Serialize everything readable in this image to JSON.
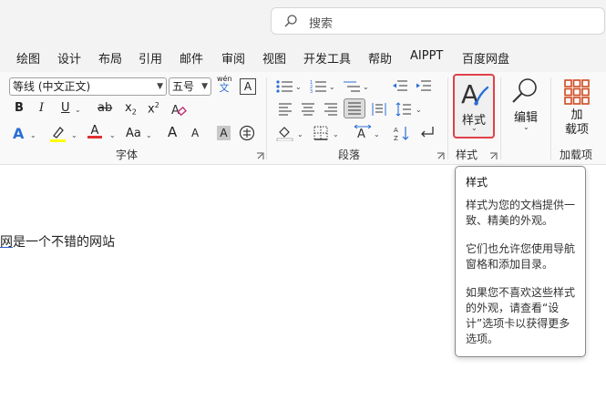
{
  "search": {
    "placeholder": "搜索",
    "icon": "search-icon"
  },
  "menu": [
    "绘图",
    "设计",
    "布局",
    "引用",
    "邮件",
    "审阅",
    "视图",
    "开发工具",
    "帮助",
    "AIPPT",
    "百度网盘"
  ],
  "font_group": {
    "font_name": "等线 (中文正文)",
    "font_size": "五号",
    "phonetic_top": "wén",
    "phonetic_bottom": "文",
    "char_border": "A",
    "bold": "B",
    "italic": "I",
    "underline": "U",
    "strike": "ab",
    "subscript": "x",
    "subscript_mark": "2",
    "superscript": "x",
    "superscript_mark": "2",
    "text_effect": "A",
    "highlight_color": "#ffff00",
    "font_color_letter": "A",
    "font_color": "#e03030",
    "change_case": "Aa",
    "grow": "A",
    "shrink": "A",
    "char_shading": "A",
    "enclose": "字",
    "label": "字体"
  },
  "paragraph_group": {
    "label": "段落"
  },
  "styles_group": {
    "button_label": "样式",
    "label": "样式"
  },
  "editing": {
    "label": "编辑"
  },
  "addins": {
    "button_label_1": "加",
    "button_label_2": "载项",
    "label": "加载项"
  },
  "document": {
    "text_first": "网",
    "text_rest": "是一个不错的网站"
  },
  "tooltip": {
    "title": "样式",
    "para1": "样式为您的文档提供一致、精美的外观。",
    "para2": "它们也允许您使用导航窗格和添加目录。",
    "para3": "如果您不喜欢这些样式的外观，请查看“设计”选项卡以获得更多选项。"
  },
  "colors": {
    "accent_red": "#e0404a",
    "addins_orange": "#d04a1e",
    "styles_blue": "#2a6fd6"
  }
}
